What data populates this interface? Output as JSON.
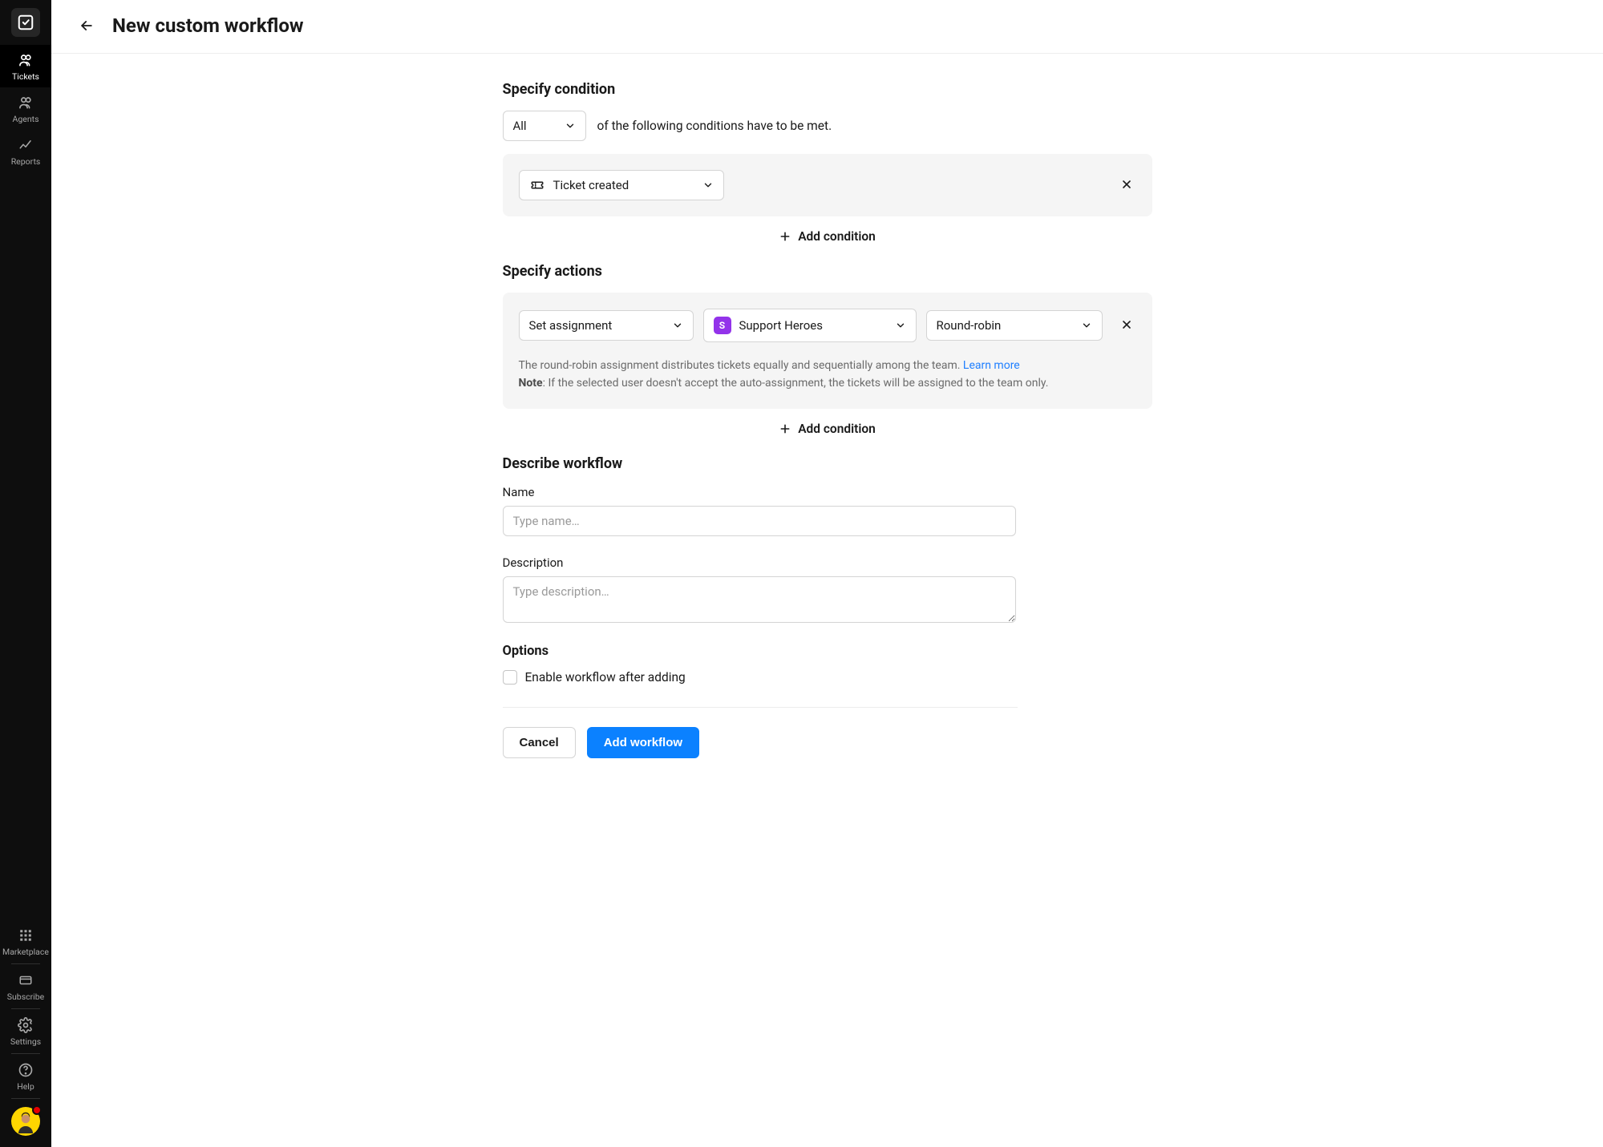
{
  "header": {
    "title": "New custom workflow"
  },
  "sidebar": {
    "nav": [
      {
        "label": "Tickets",
        "active": true
      },
      {
        "label": "Agents",
        "active": false
      },
      {
        "label": "Reports",
        "active": false
      }
    ],
    "bottom": [
      {
        "label": "Marketplace"
      },
      {
        "label": "Subscribe"
      },
      {
        "label": "Settings"
      },
      {
        "label": "Help"
      }
    ]
  },
  "condition": {
    "title": "Specify condition",
    "scope_value": "All",
    "suffix_text": "of the following conditions have to be met.",
    "trigger_value": "Ticket created",
    "add_label": "Add condition"
  },
  "actions": {
    "title": "Specify actions",
    "type_value": "Set assignment",
    "team_initial": "S",
    "team_value": "Support Heroes",
    "method_value": "Round-robin",
    "help_text_1": "The round-robin assignment distributes tickets equally and sequentially among the team. ",
    "learn_more": "Learn more",
    "note_label": "Note",
    "note_text": ": If the selected user doesn't accept the auto-assignment, the tickets will be assigned to the team only.",
    "add_label": "Add condition"
  },
  "describe": {
    "title": "Describe workflow",
    "name_label": "Name",
    "name_placeholder": "Type name…",
    "description_label": "Description",
    "description_placeholder": "Type description…"
  },
  "options": {
    "title": "Options",
    "enable_label": "Enable workflow after adding"
  },
  "buttons": {
    "cancel": "Cancel",
    "submit": "Add workflow"
  }
}
